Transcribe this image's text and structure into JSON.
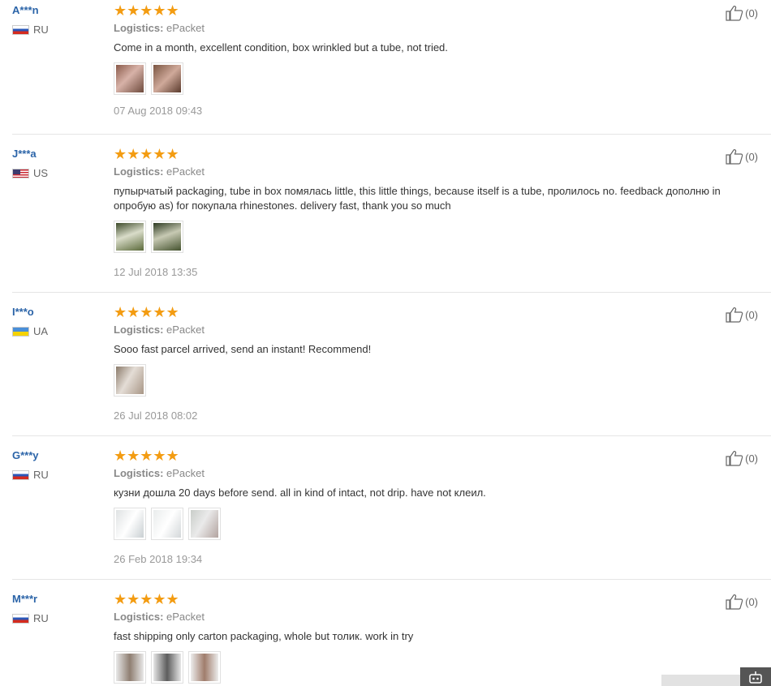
{
  "reviews": [
    {
      "user": "A***n",
      "country": "RU",
      "flag": "ru",
      "stars": "★★★★★",
      "rating": 5,
      "logistics_label": "Logistics:",
      "logistics_value": "ePacket",
      "text": "Come in a month, excellent condition, box wrinkled but a tube, not tried.",
      "photos": 2,
      "date": "07 Aug 2018 09:43",
      "helpful": "(0)"
    },
    {
      "user": "J***a",
      "country": "US",
      "flag": "us",
      "stars": "★★★★★",
      "rating": 5,
      "logistics_label": "Logistics:",
      "logistics_value": "ePacket",
      "text": "пупырчатый packaging, tube in box помялась little, this little things, because itself is a tube, пролилось no. feedback дополню in опробую as) for покупала rhinestones. delivery fast, thank you so much",
      "photos": 2,
      "date": "12 Jul 2018 13:35",
      "helpful": "(0)"
    },
    {
      "user": "I***o",
      "country": "UA",
      "flag": "ua",
      "stars": "★★★★★",
      "rating": 5,
      "logistics_label": "Logistics:",
      "logistics_value": "ePacket",
      "text": "Sooo fast parcel arrived, send an instant! Recommend!",
      "photos": 1,
      "date": "26 Jul 2018 08:02",
      "helpful": "(0)"
    },
    {
      "user": "G***y",
      "country": "RU",
      "flag": "ru",
      "stars": "★★★★★",
      "rating": 5,
      "logistics_label": "Logistics:",
      "logistics_value": "ePacket",
      "text": "кузни дошла 20 days before send. all in kind of intact, not drip. have not клеил.",
      "photos": 3,
      "date": "26 Feb 2018 19:34",
      "helpful": "(0)"
    },
    {
      "user": "M***r",
      "country": "RU",
      "flag": "ru",
      "stars": "★★★★★",
      "rating": 5,
      "logistics_label": "Logistics:",
      "logistics_value": "ePacket",
      "text": "fast shipping only carton packaging, whole but толик. work in try",
      "photos": 3,
      "date": "",
      "helpful": "(0)"
    }
  ],
  "colors": {
    "star": "#f39c12",
    "username": "#2b64a8",
    "muted": "#999999",
    "divider": "#e5e5e5"
  },
  "icons": {
    "helpful": "thumbs-up-icon",
    "star": "star-icon",
    "robot": "robot-icon"
  }
}
